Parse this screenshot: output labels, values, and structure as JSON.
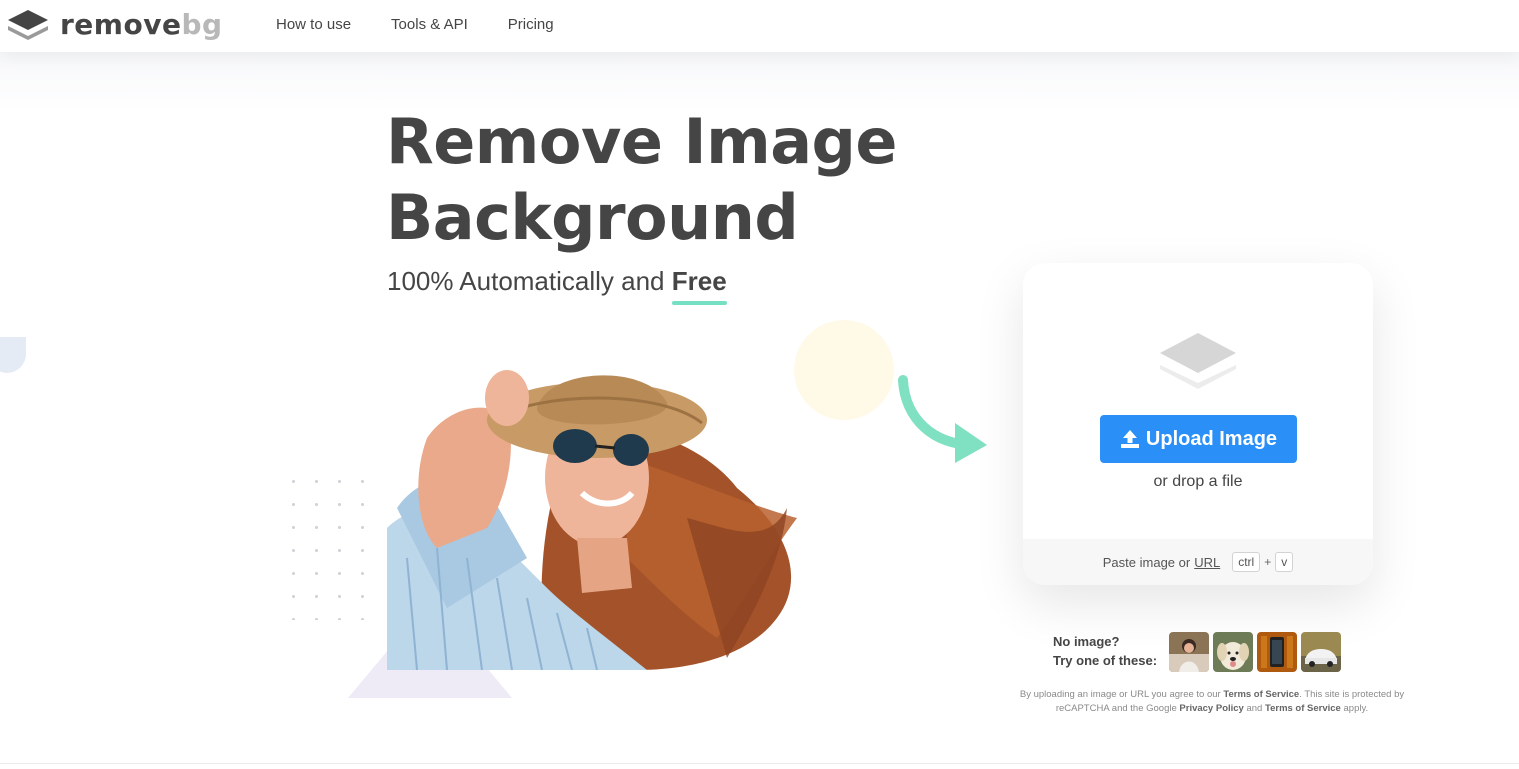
{
  "brand": {
    "word1": "remove",
    "word2": "bg",
    "logo_icon": "layers-icon"
  },
  "nav": {
    "items": [
      {
        "label": "How to use"
      },
      {
        "label": "Tools & API"
      },
      {
        "label": "Pricing"
      }
    ]
  },
  "hero": {
    "title_line1": "Remove Image",
    "title_line2": "Background",
    "subtitle_prefix": "100% Automatically and",
    "subtitle_highlight": "Free",
    "highlight_color": "#76e0c4"
  },
  "upload": {
    "button_label": "Upload Image",
    "button_icon": "upload-icon",
    "button_color": "#2a8ff7",
    "drop_text": "or drop a file",
    "paste_text": "Paste image or",
    "paste_url": "URL",
    "key1": "ctrl",
    "plus": "+",
    "key2": "v",
    "card_icon": "layers-icon"
  },
  "samples": {
    "line1": "No image?",
    "line2": "Try one of these:",
    "thumbs": [
      "woman-sample",
      "dog-sample",
      "phone-sample",
      "car-sample"
    ]
  },
  "legal": {
    "t1": "By uploading an image or URL you agree to our",
    "tos1": "Terms of Service",
    "t2": ". This site is protected by reCAPTCHA and the Google",
    "privacy": "Privacy Policy",
    "t3": "and",
    "tos2": "Terms of Service",
    "t4": "apply."
  }
}
